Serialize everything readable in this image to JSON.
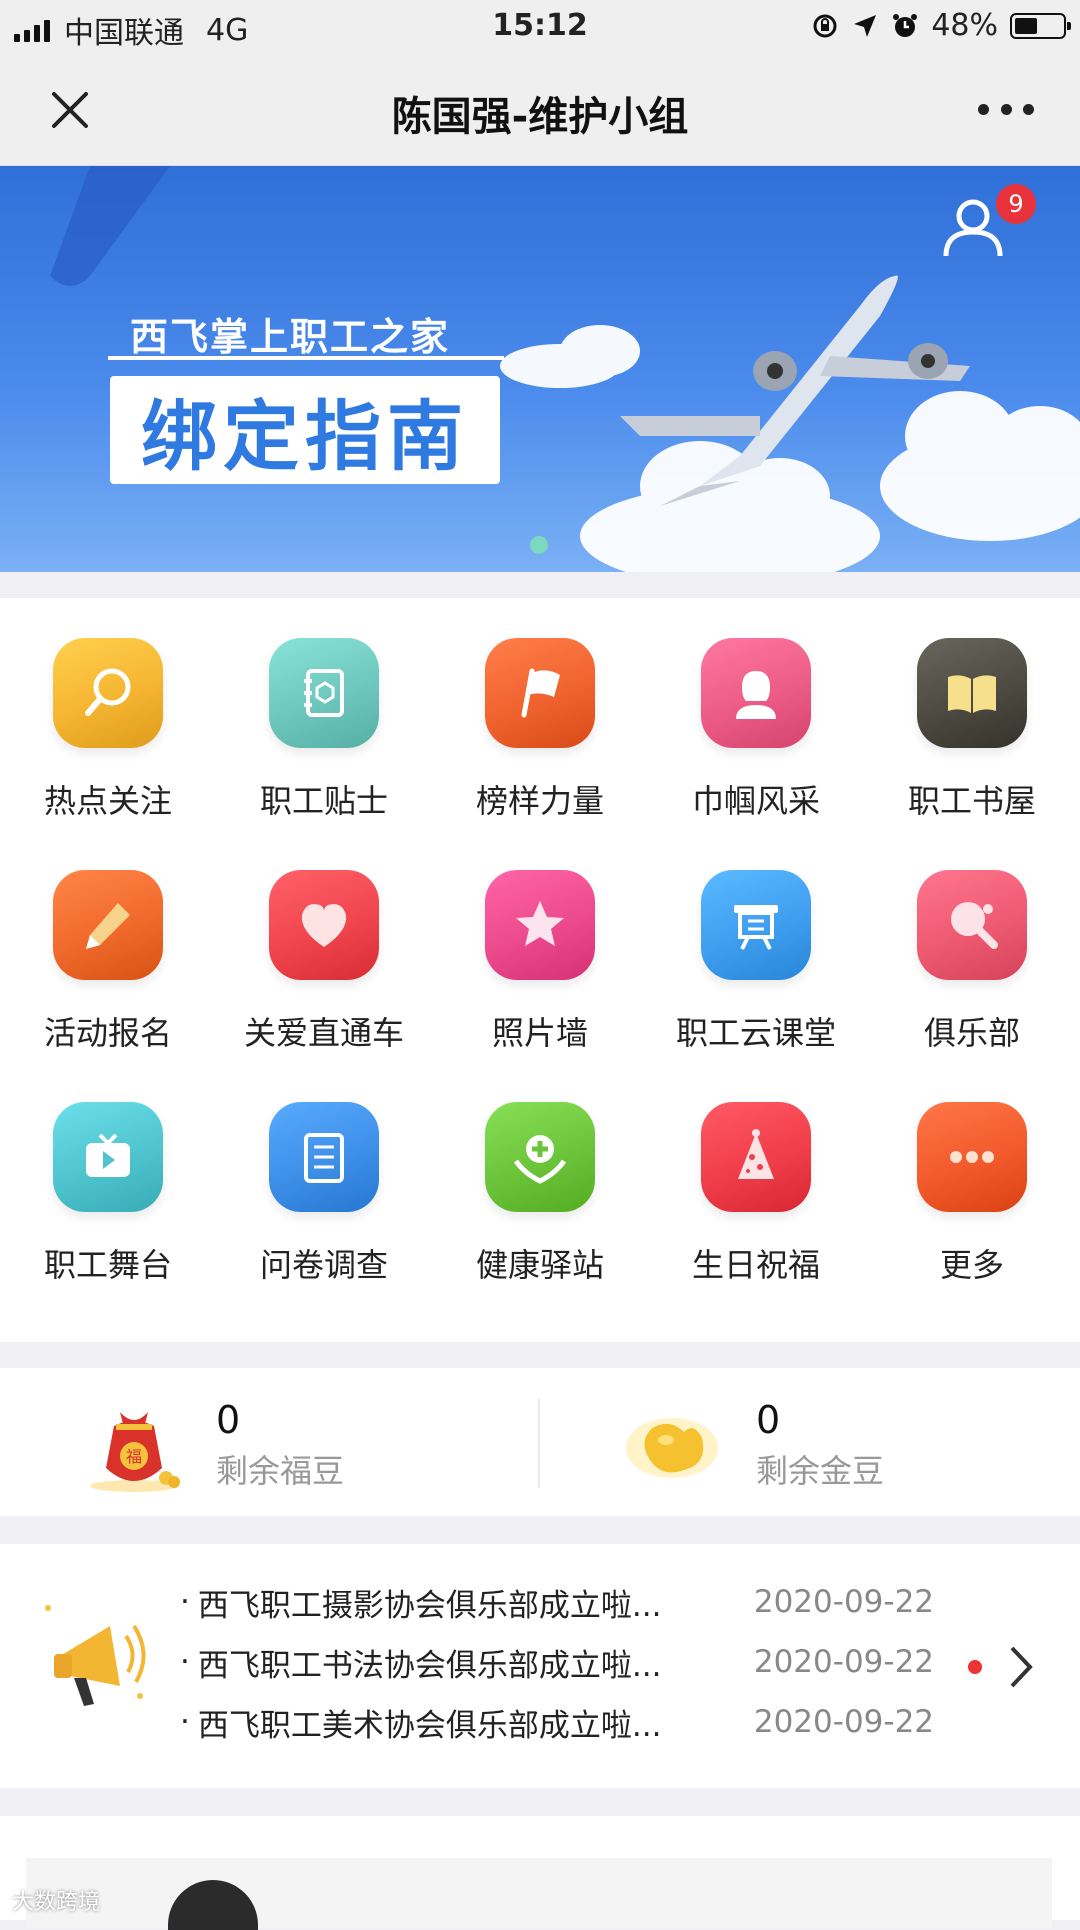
{
  "status_bar": {
    "carrier": "中国联通",
    "network": "4G",
    "time": "15:12",
    "battery": "48%",
    "battery_level": 0.48
  },
  "nav": {
    "title": "陈国强-维护小组",
    "close_icon": "close-icon",
    "more_icon": "more-icon"
  },
  "banner": {
    "subtitle": "西飞掌上职工之家",
    "title": "绑定指南",
    "badge_count": "9",
    "user_icon": "user-icon",
    "page_index": 1
  },
  "apps": [
    {
      "label": "热点关注",
      "icon": "search-icon",
      "color": "#f5b532"
    },
    {
      "label": "职工贴士",
      "icon": "notebook-icon",
      "color": "#6ec7bd"
    },
    {
      "label": "榜样力量",
      "icon": "flag-icon",
      "color": "#f0632f"
    },
    {
      "label": "巾帼风采",
      "icon": "woman-icon",
      "color": "#ec5c86"
    },
    {
      "label": "职工书屋",
      "icon": "book-icon",
      "color": "#4d4a42"
    },
    {
      "label": "活动报名",
      "icon": "pencil-icon",
      "color": "#f06a2c"
    },
    {
      "label": "关爱直通车",
      "icon": "heart-icon",
      "color": "#f0454d"
    },
    {
      "label": "照片墙",
      "icon": "star-icon",
      "color": "#ec4a8c"
    },
    {
      "label": "职工云课堂",
      "icon": "classroom-icon",
      "color": "#3f9ef0"
    },
    {
      "label": "俱乐部",
      "icon": "pingpong-icon",
      "color": "#ee5a72"
    },
    {
      "label": "职工舞台",
      "icon": "tv-icon",
      "color": "#4fc4cf"
    },
    {
      "label": "问卷调查",
      "icon": "document-icon",
      "color": "#3d8fe8"
    },
    {
      "label": "健康驿站",
      "icon": "health-icon",
      "color": "#6cc43a"
    },
    {
      "label": "生日祝福",
      "icon": "party-hat-icon",
      "color": "#f03e4a"
    },
    {
      "label": "更多",
      "icon": "more-dots-icon",
      "color": "#f25a2c"
    }
  ],
  "points": [
    {
      "value": "0",
      "label": "剩余福豆",
      "icon": "lucky-bag-icon"
    },
    {
      "value": "0",
      "label": "剩余金豆",
      "icon": "gold-bean-icon"
    }
  ],
  "news": {
    "icon": "megaphone-icon",
    "items": [
      {
        "title": "西飞职工摄影协会俱乐部成立啦...",
        "date": "2020-09-22"
      },
      {
        "title": "西飞职工书法协会俱乐部成立啦...",
        "date": "2020-09-22"
      },
      {
        "title": "西飞职工美术协会俱乐部成立啦...",
        "date": "2020-09-22"
      }
    ]
  },
  "watermark": "大数跨境"
}
